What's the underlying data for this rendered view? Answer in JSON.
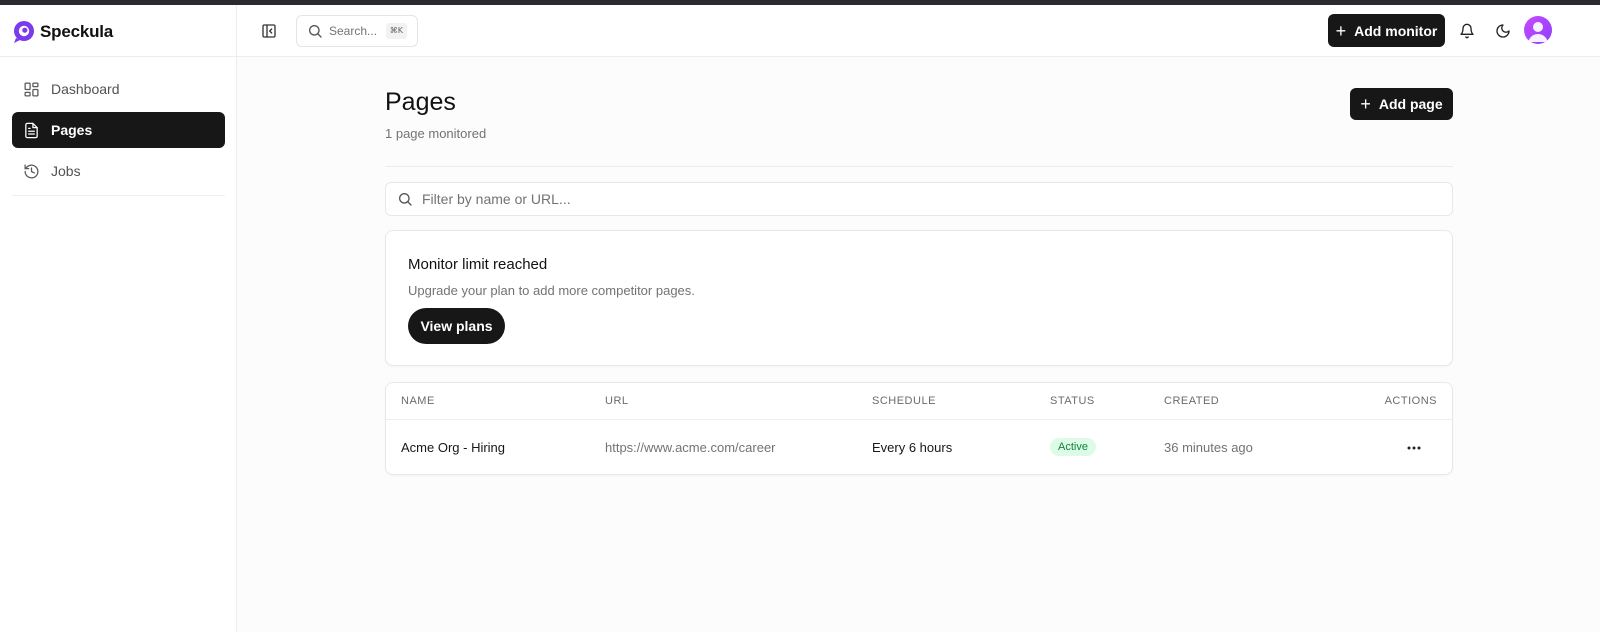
{
  "brand": {
    "name": "Speckula",
    "accent": "#7c3aed"
  },
  "sidebar": {
    "items": [
      {
        "label": "Dashboard",
        "icon": "layout-grid-icon",
        "active": false
      },
      {
        "label": "Pages",
        "icon": "file-text-icon",
        "active": true
      },
      {
        "label": "Jobs",
        "icon": "history-icon",
        "active": false
      }
    ]
  },
  "header": {
    "search_placeholder": "Search...",
    "search_shortcut": "⌘K",
    "add_monitor_label": "Add monitor",
    "icons": [
      "sidebar-toggle-icon",
      "search-icon",
      "plus-icon",
      "bell-icon",
      "moon-icon",
      "avatar"
    ]
  },
  "main": {
    "title": "Pages",
    "subtitle": "1 page monitored",
    "add_page_label": "Add page",
    "filter_placeholder": "Filter by name or URL...",
    "limit_card": {
      "title": "Monitor limit reached",
      "description": "Upgrade your plan to add more competitor pages.",
      "button_label": "View plans"
    },
    "table": {
      "columns": [
        "NAME",
        "URL",
        "SCHEDULE",
        "STATUS",
        "CREATED",
        "ACTIONS"
      ],
      "rows": [
        {
          "name": "Acme Org - Hiring",
          "url": "https://www.acme.com/career",
          "schedule": "Every 6 hours",
          "status": "Active",
          "created": "36 minutes ago"
        }
      ]
    }
  },
  "colors": {
    "primary_button": "#171717",
    "status_active_bg": "#dcfce7",
    "status_active_text": "#15803d"
  }
}
